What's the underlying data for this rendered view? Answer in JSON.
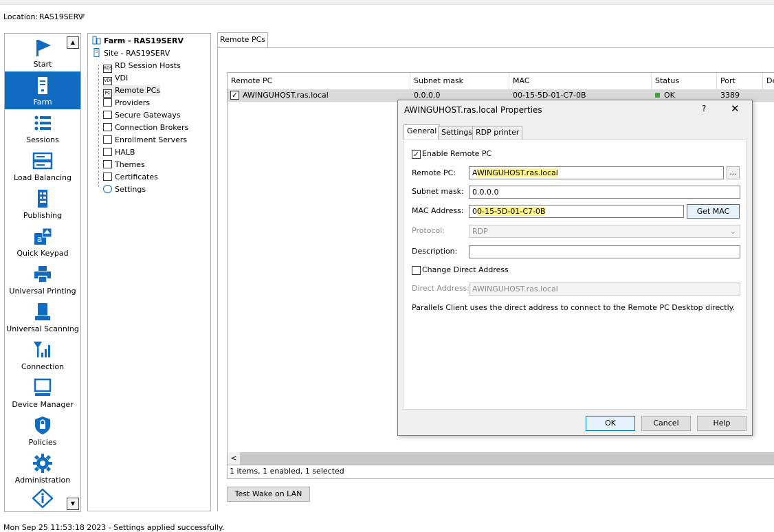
{
  "location": {
    "label": "Location:",
    "value": "RAS19SERV"
  },
  "nav": {
    "items": [
      {
        "label": "Start",
        "icon": "flag-icon"
      },
      {
        "label": "Farm",
        "icon": "server-icon"
      },
      {
        "label": "Sessions",
        "icon": "list-icon"
      },
      {
        "label": "Load Balancing",
        "icon": "load-balancing-icon"
      },
      {
        "label": "Publishing",
        "icon": "publishing-icon"
      },
      {
        "label": "Quick Keypad",
        "icon": "quick-keypad-icon"
      },
      {
        "label": "Universal Printing",
        "icon": "printer-icon"
      },
      {
        "label": "Universal Scanning",
        "icon": "scanner-icon"
      },
      {
        "label": "Connection",
        "icon": "connection-icon"
      },
      {
        "label": "Device Manager",
        "icon": "monitor-icon"
      },
      {
        "label": "Policies",
        "icon": "policy-icon"
      },
      {
        "label": "Administration",
        "icon": "gear-icon"
      }
    ]
  },
  "tree": {
    "farm": "Farm - RAS19SERV",
    "site": "Site - RAS19SERV",
    "items": [
      "RD Session Hosts",
      "VDI",
      "Remote PCs",
      "Providers",
      "Secure Gateways",
      "Connection Brokers",
      "Enrollment Servers",
      "HALB",
      "Themes",
      "Certificates",
      "Settings"
    ],
    "icon_text": [
      "RDS",
      "VDI",
      "PC"
    ]
  },
  "main": {
    "tab": "Remote PCs",
    "columns": [
      "Remote PC",
      "Subnet mask",
      "MAC",
      "Status",
      "Port",
      "De"
    ],
    "row": {
      "name": "AWINGUHOST.ras.local",
      "subnet": "0.0.0.0",
      "mac": "00-15-5D-01-C7-0B",
      "status": "OK",
      "port": "3389"
    },
    "grid_status": "1 items, 1 enabled, 1 selected",
    "wake_button": "Test Wake on LAN",
    "scroll_left": "<"
  },
  "statusbar": "Mon Sep 25 11:53:18 2023 - Settings applied successfully.",
  "dialog": {
    "title": "AWINGUHOST.ras.local Properties",
    "help": "?",
    "close": "✕",
    "tabs": [
      "General",
      "Settings",
      "RDP printer"
    ],
    "enable_label": "Enable Remote PC",
    "remote_pc_label": "Remote PC:",
    "remote_pc_first": "A",
    "remote_pc_rest": "WINGUHOST.ras.local",
    "browse": "...",
    "subnet_label": "Subnet mask:",
    "subnet_value": "0.0.0.0",
    "mac_label": "MAC Address:",
    "mac_first": "0",
    "mac_rest": "0-15-5D-01-C7-0B",
    "get_mac": "Get MAC",
    "protocol_label": "Protocol:",
    "protocol_value": "RDP",
    "description_label": "Description:",
    "change_direct_label": "Change Direct Address",
    "direct_address_label": "Direct Address:",
    "direct_address_value": "AWINGUHOST.ras.local",
    "info": "Parallels Client uses the direct address to connect to the Remote PC Desktop directly.",
    "ok": "OK",
    "cancel": "Cancel",
    "help_button": "Help"
  }
}
